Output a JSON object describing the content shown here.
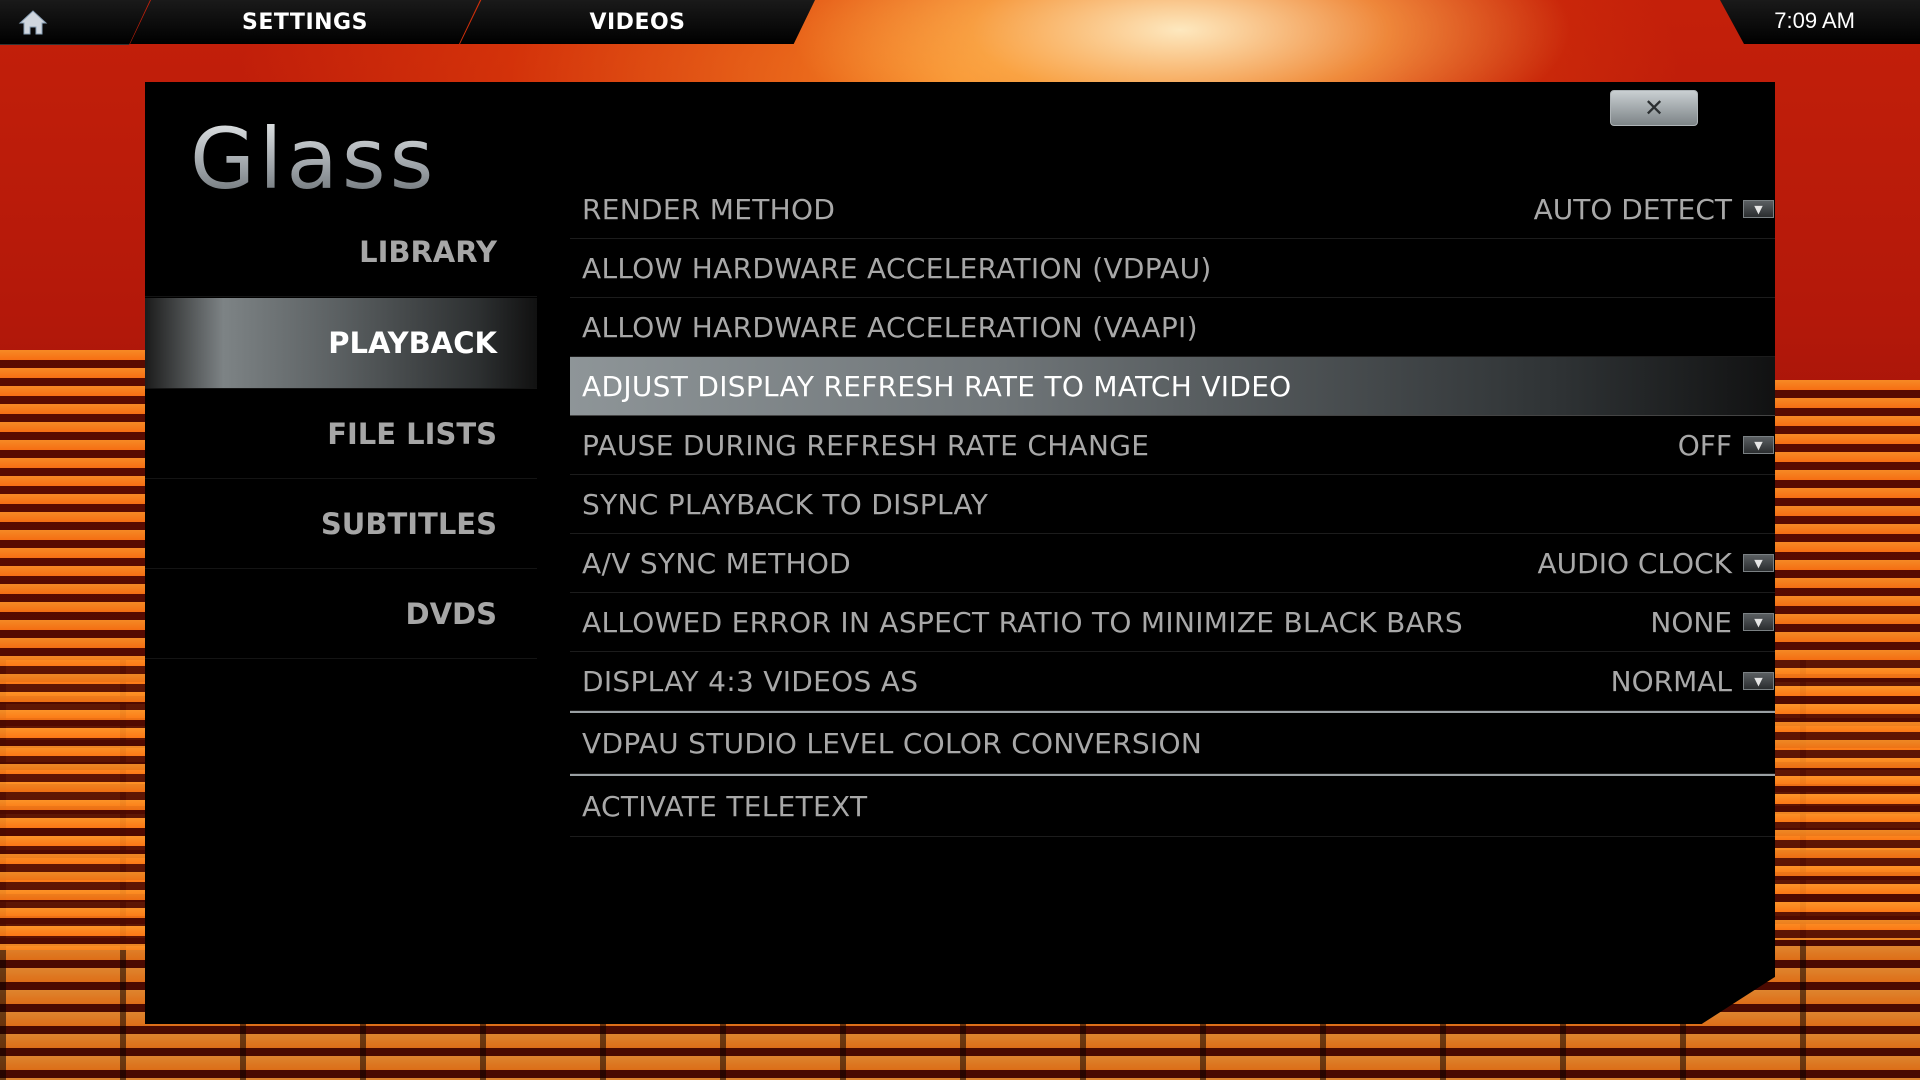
{
  "topbar": {
    "home_icon": "home-icon",
    "tab1": "SETTINGS",
    "tab2": "VIDEOS",
    "time": "7:09 AM"
  },
  "panel": {
    "logo": "Glass",
    "close_icon": "close-icon"
  },
  "sidebar": {
    "items": [
      {
        "label": "LIBRARY",
        "active": false
      },
      {
        "label": "PLAYBACK",
        "active": true
      },
      {
        "label": "FILE LISTS",
        "active": false
      },
      {
        "label": "SUBTITLES",
        "active": false
      },
      {
        "label": "DVDS",
        "active": false
      }
    ]
  },
  "settings": {
    "rows": [
      {
        "label": "RENDER METHOD",
        "value": "AUTO DETECT",
        "control": "spinner"
      },
      {
        "label": "ALLOW HARDWARE ACCELERATION (VDPAU)",
        "control": "radio",
        "checked": false
      },
      {
        "label": "ALLOW HARDWARE ACCELERATION (VAAPI)",
        "control": "radio",
        "checked": true
      },
      {
        "label": "ADJUST DISPLAY REFRESH RATE TO MATCH VIDEO",
        "control": "radio",
        "checked": true,
        "selected": true
      },
      {
        "label": "PAUSE DURING REFRESH RATE CHANGE",
        "value": "OFF",
        "control": "spinner"
      },
      {
        "label": "SYNC PLAYBACK TO DISPLAY",
        "control": "radio",
        "checked": true
      },
      {
        "label": "A/V SYNC METHOD",
        "value": "AUDIO CLOCK",
        "control": "spinner"
      },
      {
        "label": "ALLOWED ERROR IN ASPECT RATIO TO MINIMIZE BLACK BARS",
        "value": "NONE",
        "control": "spinner"
      },
      {
        "label": "DISPLAY 4:3 VIDEOS AS",
        "value": "NORMAL",
        "control": "spinner"
      },
      {
        "label": "VDPAU STUDIO LEVEL COLOR CONVERSION",
        "control": "radio",
        "checked": false
      },
      {
        "label": "ACTIVATE TELETEXT",
        "control": "radio",
        "checked": true
      }
    ]
  },
  "colors": {
    "accent_radio": "#3a86c2",
    "text_dim": "#a8a8a8",
    "text_active": "#ffffff"
  }
}
